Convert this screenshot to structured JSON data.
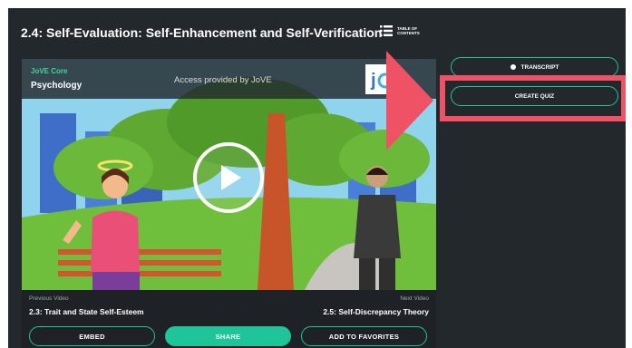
{
  "page": {
    "title": "2.4: Self-Evaluation: Self-Enhancement and Self-Verification",
    "toc_label": "TABLE OF CONTENTS"
  },
  "video": {
    "banner_subtitle": "JoVE Core",
    "banner_title": "Psychology",
    "access_text": "Access provided by JoVE",
    "logo_text": "jo"
  },
  "navigation": {
    "previous_caption": "Previous Video",
    "previous_title": "2.3: Trait and State Self-Esteem",
    "next_caption": "Next Video",
    "next_title": "2.5: Self-Discrepancy Theory"
  },
  "actions": {
    "embed_label": "EMBED",
    "share_label": "SHARE",
    "favorites_label": "ADD TO FAVORITES"
  },
  "sidebar": {
    "transcript_label": "TRANSCRIPT",
    "create_quiz_label": "CREATE QUIZ"
  },
  "colors": {
    "background": "#23282d",
    "accent": "#1fc498",
    "highlight": "#ef5264"
  }
}
